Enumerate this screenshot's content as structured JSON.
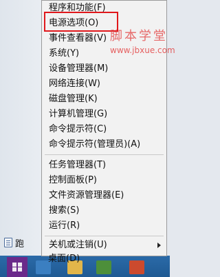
{
  "context_menu": {
    "items": [
      {
        "label": "程序和功能(F)"
      },
      {
        "label": "电源选项(O)"
      },
      {
        "label": "事件查看器(V)"
      },
      {
        "label": "系统(Y)"
      },
      {
        "label": "设备管理器(M)"
      },
      {
        "label": "网络连接(W)"
      },
      {
        "label": "磁盘管理(K)"
      },
      {
        "label": "计算机管理(G)"
      },
      {
        "label": "命令提示符(C)"
      },
      {
        "label": "命令提示符(管理员)(A)"
      },
      {
        "label": "任务管理器(T)"
      },
      {
        "label": "控制面板(P)"
      },
      {
        "label": "文件资源管理器(E)"
      },
      {
        "label": "搜索(S)"
      },
      {
        "label": "运行(R)"
      },
      {
        "label": "关机或注销(U)"
      },
      {
        "label": "桌面(D)"
      }
    ],
    "highlighted_item": "电源选项(O)",
    "highlight_color": "#e0171b"
  },
  "watermark": {
    "title": "脚本学堂",
    "url": "www.jbxue.com"
  },
  "behind_menu": {
    "item_label": "跑"
  },
  "taskbar": {
    "start_color": "#6a2a8a",
    "bar_color": "#1f5a93"
  }
}
